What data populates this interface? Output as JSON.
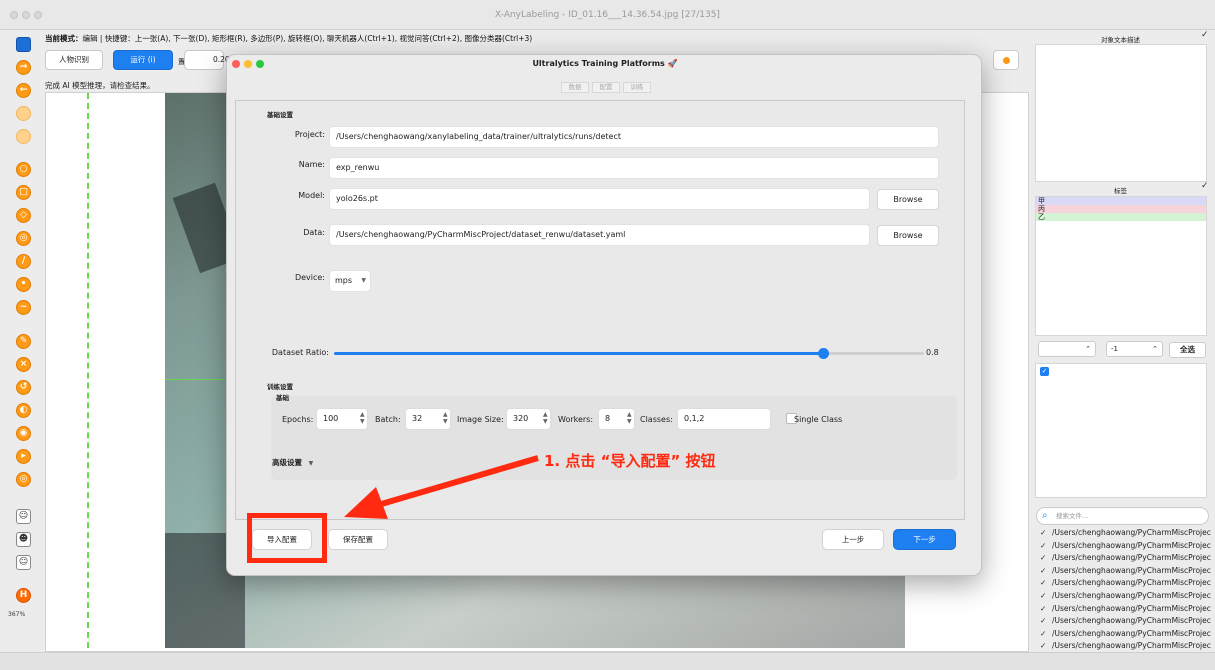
{
  "app": {
    "title": "X-AnyLabeling - ID_01.16___14.36.54.jpg [27/135]",
    "zoom": "367%"
  },
  "toolbar": {
    "mode_prefix": "当前模式：",
    "shortcuts_text": "编辑 | 快捷键：上一张(A), 下一张(D), 矩形框(R), 多边形(P), 旋转框(O), 聊天机器人(Ctrl+1), 视觉问答(Ctrl+2), 图像分类器(Ctrl+3)",
    "btn_person": "人物识别",
    "btn_run": "运行 (i)",
    "conf_label": "置信度",
    "conf_value": "0.20",
    "status": "完成 AI 模型推理，请检查结果。"
  },
  "right": {
    "desc_title": "对象文本描述",
    "label_title": "标签",
    "labels": [
      {
        "text": "甲",
        "color": "#d9d9f7"
      },
      {
        "text": "丙",
        "color": "#f7d4dc"
      },
      {
        "text": "乙",
        "color": "#d4f3d4"
      }
    ],
    "spin1": "",
    "spin2": "-1",
    "select_all": "全选",
    "search_placeholder": "搜索文件...",
    "files": [
      "/Users/chenghaowang/PyCharmMiscProjec",
      "/Users/chenghaowang/PyCharmMiscProjec",
      "/Users/chenghaowang/PyCharmMiscProjec",
      "/Users/chenghaowang/PyCharmMiscProjec",
      "/Users/chenghaowang/PyCharmMiscProjec",
      "/Users/chenghaowang/PyCharmMiscProjec",
      "/Users/chenghaowang/PyCharmMiscProjec",
      "/Users/chenghaowang/PyCharmMiscProjec",
      "/Users/chenghaowang/PyCharmMiscProjec",
      "/Users/chenghaowang/PyCharmMiscProjec"
    ]
  },
  "dialog": {
    "title": "Ultralytics Training Platforms 🚀",
    "steps": [
      "数据",
      "配置",
      "训练"
    ],
    "basic_section": "基础设置",
    "project_label": "Project:",
    "project_value": "/Users/chenghaowang/xanylabeling_data/trainer/ultralytics/runs/detect",
    "name_label": "Name:",
    "name_value": "exp_renwu",
    "model_label": "Model:",
    "model_value": "yolo26s.pt",
    "data_label": "Data:",
    "data_value": "/Users/chenghaowang/PyCharmMiscProject/dataset_renwu/dataset.yaml",
    "browse": "Browse",
    "device_label": "Device:",
    "device_value": "mps",
    "ratio_label": "Dataset Ratio:",
    "ratio_value": "0.8",
    "ratio_fraction": 0.8,
    "train_section": "训练设置",
    "basic_sub": "基础",
    "epochs_label": "Epochs:",
    "epochs": "100",
    "batch_label": "Batch:",
    "batch": "32",
    "imgsize_label": "Image Size:",
    "imgsize": "320",
    "workers_label": "Workers:",
    "workers": "8",
    "classes_label": "Classes:",
    "classes": "0,1,2",
    "single_class": "Single Class",
    "advanced": "高级设置",
    "import_btn": "导入配置",
    "save_btn": "保存配置",
    "prev_btn": "上一步",
    "next_btn": "下一步"
  },
  "annotation": {
    "text": "1. 点击 “导入配置” 按钮",
    "color": "#ff2a0f"
  }
}
